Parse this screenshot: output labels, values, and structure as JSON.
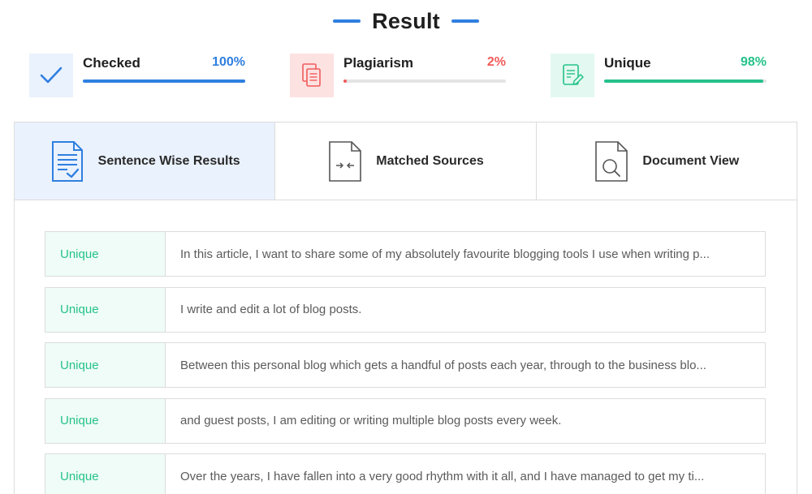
{
  "header": {
    "title": "Result"
  },
  "stats": {
    "checked": {
      "label": "Checked",
      "value": "100%",
      "fraction": 1.0,
      "icon": "checkmark-icon",
      "color": "#2f7fe0"
    },
    "plagiarism": {
      "label": "Plagiarism",
      "value": "2%",
      "fraction": 0.02,
      "icon": "copy-documents-icon",
      "color": "#f15b5b"
    },
    "unique": {
      "label": "Unique",
      "value": "98%",
      "fraction": 0.98,
      "icon": "edit-document-icon",
      "color": "#25c28a"
    }
  },
  "tabs": [
    {
      "label": "Sentence Wise Results",
      "icon": "checked-document-icon",
      "active": true
    },
    {
      "label": "Matched Sources",
      "icon": "compare-document-icon",
      "active": false
    },
    {
      "label": "Document View",
      "icon": "search-document-icon",
      "active": false
    }
  ],
  "results": [
    {
      "tag": "Unique",
      "text": "In this article, I want to share some of my absolutely favourite blogging tools I use when writing p..."
    },
    {
      "tag": "Unique",
      "text": "I write and edit a lot of blog posts."
    },
    {
      "tag": "Unique",
      "text": "Between this personal blog which gets a handful of posts each year, through to the business blo..."
    },
    {
      "tag": "Unique",
      "text": "and guest posts, I am editing or writing multiple blog posts every week."
    },
    {
      "tag": "Unique",
      "text": "Over the years, I have fallen into a very good rhythm with it all, and I have managed to get my ti..."
    }
  ]
}
